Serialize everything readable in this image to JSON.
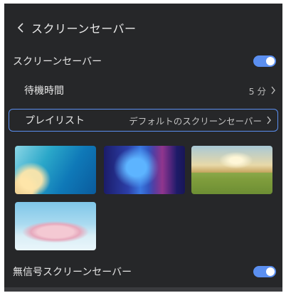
{
  "header": {
    "back_icon": "chevron-left-icon",
    "title": "スクリーンセーバー"
  },
  "screensaver": {
    "label": "スクリーンセーバー",
    "enabled": true
  },
  "wait_time": {
    "label": "待機時間",
    "value": "5 分"
  },
  "playlist": {
    "label": "プレイリスト",
    "value": "デフォルトのスクリーンセーバー"
  },
  "thumbnails": [
    {
      "icon": "beach-aerial-image"
    },
    {
      "icon": "abstract-blue-image"
    },
    {
      "icon": "landscape-valley-image"
    },
    {
      "icon": "frosted-trees-image"
    }
  ],
  "no_signal": {
    "label": "無信号スクリーンセーバー",
    "enabled": true
  },
  "colors": {
    "accent": "#5b8ff0",
    "background": "#262729",
    "text": "#e8e8e8"
  }
}
